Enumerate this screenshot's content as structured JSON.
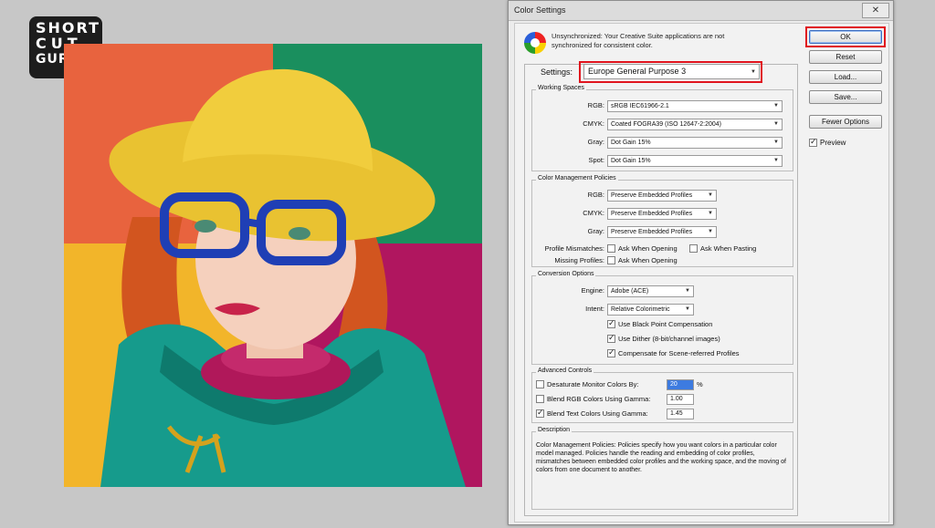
{
  "logo": {
    "line1": "SHORT",
    "line2": "CUT",
    "line3": "GURU"
  },
  "colors": {
    "accent_red": "#e0141e",
    "ok_blue": "#3b6fc2",
    "highlight": "#3d7be0"
  },
  "dialog": {
    "title": "Color Settings",
    "close_label": "✕",
    "message_line1": "Unsynchronized: Your Creative Suite applications are not",
    "message_line2": "synchronized for consistent color.",
    "settings_label": "Settings:",
    "settings_value": "Europe General Purpose 3",
    "buttons": {
      "ok": "OK",
      "reset": "Reset",
      "load": "Load...",
      "save": "Save...",
      "fewer": "Fewer Options"
    },
    "preview_label": "Preview",
    "working_spaces": {
      "title": "Working Spaces",
      "rows": [
        {
          "label": "RGB:",
          "value": "sRGB IEC61966-2.1"
        },
        {
          "label": "CMYK:",
          "value": "Coated FOGRA39 (ISO 12647-2:2004)"
        },
        {
          "label": "Gray:",
          "value": "Dot Gain 15%"
        },
        {
          "label": "Spot:",
          "value": "Dot Gain 15%"
        }
      ]
    },
    "policies": {
      "title": "Color Management Policies",
      "rows": [
        {
          "label": "RGB:",
          "value": "Preserve Embedded Profiles"
        },
        {
          "label": "CMYK:",
          "value": "Preserve Embedded Profiles"
        },
        {
          "label": "Gray:",
          "value": "Preserve Embedded Profiles"
        }
      ],
      "mismatch_label": "Profile Mismatches:",
      "ask_opening": "Ask When Opening",
      "ask_pasting": "Ask When Pasting",
      "missing_label": "Missing Profiles:",
      "ask_opening2": "Ask When Opening"
    },
    "conversion": {
      "title": "Conversion Options",
      "engine_label": "Engine:",
      "engine_value": "Adobe (ACE)",
      "intent_label": "Intent:",
      "intent_value": "Relative Colorimetric",
      "bpc": "Use Black Point Compensation",
      "dither": "Use Dither (8-bit/channel images)",
      "scene": "Compensate for Scene-referred Profiles"
    },
    "advanced": {
      "title": "Advanced Controls",
      "desaturate": "Desaturate Monitor Colors By:",
      "desaturate_value": "20",
      "percent": "%",
      "blend_rgb": "Blend RGB Colors Using Gamma:",
      "blend_rgb_value": "1.00",
      "blend_text": "Blend Text Colors Using Gamma:",
      "blend_text_value": "1.45"
    },
    "description": {
      "title": "Description",
      "text": "Color Management Policies: Policies specify how you want colors in a particular color model managed. Policies handle the reading and embedding of color profiles, mismatches between embedded color profiles and the working space, and the moving of colors from one document to another."
    }
  }
}
